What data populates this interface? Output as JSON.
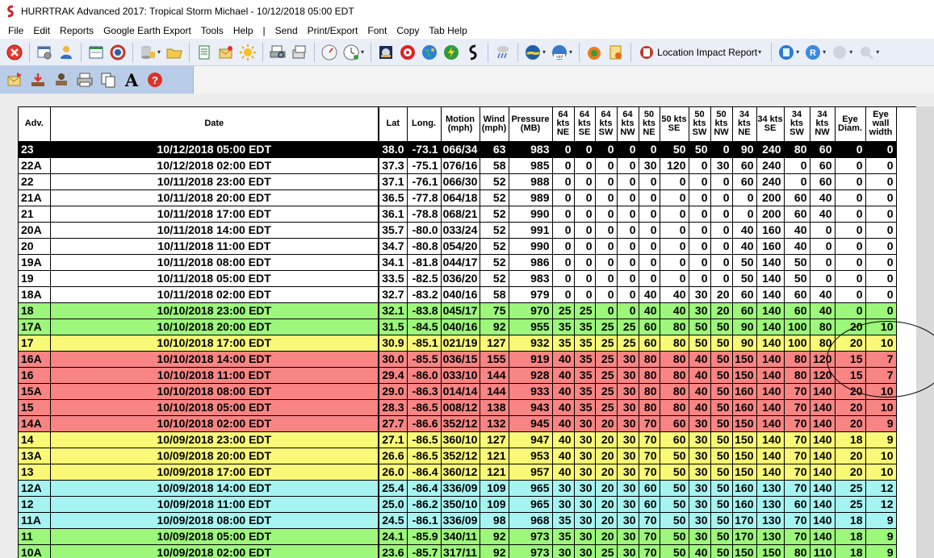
{
  "window": {
    "title": "HURRTRAK Advanced 2017: Tropical Storm Michael - 10/12/2018 05:00 EDT"
  },
  "menu": [
    "File",
    "Edit",
    "Reports",
    "Google Earth Export",
    "Tools",
    "Help",
    "|",
    "Send",
    "Print/Export",
    "Font",
    "Copy",
    "Tab Help"
  ],
  "toolbar": {
    "location_report_label": "Location Impact Report"
  },
  "columns": [
    "Adv.",
    "Date",
    "Lat",
    "Long.",
    "Motion (mph)",
    "Wind (mph)",
    "Pressure (MB)",
    "64 kts NE",
    "64 kts SE",
    "64 kts SW",
    "64 kts NW",
    "50 kts NE",
    "50 kts SE",
    "50 kts SW",
    "50 kts NW",
    "34 kts NE",
    "34 kts SE",
    "34 kts SW",
    "34 kts NW",
    "Eye Diam.",
    "Eye wall width"
  ],
  "row_colors": {
    "black": "#000000",
    "white": "#ffffff",
    "green": "#9cf77a",
    "yellow": "#f9f977",
    "red": "#f98484",
    "cyan": "#a6f4f1"
  },
  "rows": [
    {
      "style": "black",
      "cells": [
        "23",
        "10/12/2018 05:00 EDT",
        "38.0",
        "-73.1",
        "066/34",
        "63",
        "983",
        "0",
        "0",
        "0",
        "0",
        "0",
        "50",
        "50",
        "0",
        "90",
        "240",
        "80",
        "60",
        "0",
        "0"
      ]
    },
    {
      "style": "white",
      "cells": [
        "22A",
        "10/12/2018 02:00 EDT",
        "37.3",
        "-75.1",
        "076/16",
        "58",
        "985",
        "0",
        "0",
        "0",
        "0",
        "30",
        "120",
        "0",
        "30",
        "60",
        "240",
        "0",
        "60",
        "0",
        "0"
      ]
    },
    {
      "style": "white",
      "cells": [
        "22",
        "10/11/2018 23:00 EDT",
        "37.1",
        "-76.1",
        "066/30",
        "52",
        "988",
        "0",
        "0",
        "0",
        "0",
        "0",
        "0",
        "0",
        "0",
        "60",
        "240",
        "0",
        "60",
        "0",
        "0"
      ]
    },
    {
      "style": "white",
      "cells": [
        "21A",
        "10/11/2018 20:00 EDT",
        "36.5",
        "-77.8",
        "064/18",
        "52",
        "989",
        "0",
        "0",
        "0",
        "0",
        "0",
        "0",
        "0",
        "0",
        "0",
        "200",
        "60",
        "40",
        "0",
        "0"
      ]
    },
    {
      "style": "white",
      "cells": [
        "21",
        "10/11/2018 17:00 EDT",
        "36.1",
        "-78.8",
        "068/21",
        "52",
        "990",
        "0",
        "0",
        "0",
        "0",
        "0",
        "0",
        "0",
        "0",
        "0",
        "200",
        "60",
        "40",
        "0",
        "0"
      ]
    },
    {
      "style": "white",
      "cells": [
        "20A",
        "10/11/2018 14:00 EDT",
        "35.7",
        "-80.0",
        "033/24",
        "52",
        "991",
        "0",
        "0",
        "0",
        "0",
        "0",
        "0",
        "0",
        "0",
        "40",
        "160",
        "40",
        "0",
        "0",
        "0"
      ]
    },
    {
      "style": "white",
      "cells": [
        "20",
        "10/11/2018 11:00 EDT",
        "34.7",
        "-80.8",
        "054/20",
        "52",
        "990",
        "0",
        "0",
        "0",
        "0",
        "0",
        "0",
        "0",
        "0",
        "40",
        "160",
        "40",
        "0",
        "0",
        "0"
      ]
    },
    {
      "style": "white",
      "cells": [
        "19A",
        "10/11/2018 08:00 EDT",
        "34.1",
        "-81.8",
        "044/17",
        "52",
        "986",
        "0",
        "0",
        "0",
        "0",
        "0",
        "0",
        "0",
        "0",
        "50",
        "140",
        "50",
        "0",
        "0",
        "0"
      ]
    },
    {
      "style": "white",
      "cells": [
        "19",
        "10/11/2018 05:00 EDT",
        "33.5",
        "-82.5",
        "036/20",
        "52",
        "983",
        "0",
        "0",
        "0",
        "0",
        "0",
        "0",
        "0",
        "0",
        "50",
        "140",
        "50",
        "0",
        "0",
        "0"
      ]
    },
    {
      "style": "white",
      "cells": [
        "18A",
        "10/11/2018 02:00 EDT",
        "32.7",
        "-83.2",
        "040/16",
        "58",
        "979",
        "0",
        "0",
        "0",
        "0",
        "40",
        "40",
        "30",
        "20",
        "60",
        "140",
        "60",
        "40",
        "0",
        "0"
      ]
    },
    {
      "style": "green",
      "cells": [
        "18",
        "10/10/2018 23:00 EDT",
        "32.1",
        "-83.8",
        "045/17",
        "75",
        "970",
        "25",
        "25",
        "0",
        "0",
        "40",
        "40",
        "30",
        "20",
        "60",
        "140",
        "60",
        "40",
        "0",
        "0"
      ]
    },
    {
      "style": "green",
      "cells": [
        "17A",
        "10/10/2018 20:00 EDT",
        "31.5",
        "-84.5",
        "040/16",
        "92",
        "955",
        "35",
        "35",
        "25",
        "25",
        "60",
        "80",
        "50",
        "50",
        "90",
        "140",
        "100",
        "80",
        "20",
        "10"
      ]
    },
    {
      "style": "yellow",
      "cells": [
        "17",
        "10/10/2018 17:00 EDT",
        "30.9",
        "-85.1",
        "021/19",
        "127",
        "932",
        "35",
        "35",
        "25",
        "25",
        "60",
        "80",
        "50",
        "50",
        "90",
        "140",
        "100",
        "80",
        "20",
        "10"
      ]
    },
    {
      "style": "red",
      "cells": [
        "16A",
        "10/10/2018 14:00 EDT",
        "30.0",
        "-85.5",
        "036/15",
        "155",
        "919",
        "40",
        "35",
        "25",
        "30",
        "80",
        "80",
        "40",
        "50",
        "150",
        "140",
        "80",
        "120",
        "15",
        "7"
      ]
    },
    {
      "style": "red",
      "cells": [
        "16",
        "10/10/2018 11:00 EDT",
        "29.4",
        "-86.0",
        "033/10",
        "144",
        "928",
        "40",
        "35",
        "25",
        "30",
        "80",
        "80",
        "40",
        "50",
        "150",
        "140",
        "80",
        "120",
        "15",
        "7"
      ]
    },
    {
      "style": "red",
      "cells": [
        "15A",
        "10/10/2018 08:00 EDT",
        "29.0",
        "-86.3",
        "014/14",
        "144",
        "933",
        "40",
        "35",
        "25",
        "30",
        "80",
        "80",
        "40",
        "50",
        "160",
        "140",
        "70",
        "140",
        "20",
        "10"
      ]
    },
    {
      "style": "red",
      "cells": [
        "15",
        "10/10/2018 05:00 EDT",
        "28.3",
        "-86.5",
        "008/12",
        "138",
        "943",
        "40",
        "35",
        "25",
        "30",
        "80",
        "80",
        "40",
        "50",
        "160",
        "140",
        "70",
        "140",
        "20",
        "10"
      ]
    },
    {
      "style": "red",
      "cells": [
        "14A",
        "10/10/2018 02:00 EDT",
        "27.7",
        "-86.6",
        "352/12",
        "132",
        "945",
        "40",
        "30",
        "20",
        "30",
        "70",
        "60",
        "30",
        "50",
        "150",
        "140",
        "70",
        "140",
        "20",
        "9"
      ]
    },
    {
      "style": "yellow",
      "cells": [
        "14",
        "10/09/2018 23:00 EDT",
        "27.1",
        "-86.5",
        "360/10",
        "127",
        "947",
        "40",
        "30",
        "20",
        "30",
        "70",
        "60",
        "30",
        "50",
        "150",
        "140",
        "70",
        "140",
        "18",
        "9"
      ]
    },
    {
      "style": "yellow",
      "cells": [
        "13A",
        "10/09/2018 20:00 EDT",
        "26.6",
        "-86.5",
        "352/12",
        "121",
        "953",
        "40",
        "30",
        "20",
        "30",
        "70",
        "50",
        "30",
        "50",
        "150",
        "140",
        "70",
        "140",
        "20",
        "10"
      ]
    },
    {
      "style": "yellow",
      "cells": [
        "13",
        "10/09/2018 17:00 EDT",
        "26.0",
        "-86.4",
        "360/12",
        "121",
        "957",
        "40",
        "30",
        "20",
        "30",
        "70",
        "50",
        "30",
        "50",
        "150",
        "140",
        "70",
        "140",
        "20",
        "10"
      ]
    },
    {
      "style": "cyan",
      "cells": [
        "12A",
        "10/09/2018 14:00 EDT",
        "25.4",
        "-86.4",
        "336/09",
        "109",
        "965",
        "30",
        "30",
        "20",
        "30",
        "60",
        "50",
        "30",
        "50",
        "160",
        "130",
        "70",
        "140",
        "25",
        "12"
      ]
    },
    {
      "style": "cyan",
      "cells": [
        "12",
        "10/09/2018 11:00 EDT",
        "25.0",
        "-86.2",
        "350/10",
        "109",
        "965",
        "30",
        "30",
        "20",
        "30",
        "60",
        "50",
        "30",
        "50",
        "160",
        "130",
        "60",
        "140",
        "25",
        "12"
      ]
    },
    {
      "style": "cyan",
      "cells": [
        "11A",
        "10/09/2018 08:00 EDT",
        "24.5",
        "-86.1",
        "336/09",
        "98",
        "968",
        "35",
        "30",
        "20",
        "30",
        "70",
        "50",
        "30",
        "50",
        "170",
        "130",
        "70",
        "140",
        "18",
        "9"
      ]
    },
    {
      "style": "green",
      "cells": [
        "11",
        "10/09/2018 05:00 EDT",
        "24.1",
        "-85.9",
        "340/11",
        "92",
        "973",
        "35",
        "30",
        "20",
        "30",
        "70",
        "50",
        "30",
        "50",
        "170",
        "130",
        "70",
        "140",
        "18",
        "9"
      ]
    },
    {
      "style": "green",
      "cells": [
        "10A",
        "10/09/2018 02:00 EDT",
        "23.6",
        "-85.7",
        "317/11",
        "92",
        "973",
        "30",
        "30",
        "25",
        "30",
        "70",
        "50",
        "40",
        "50",
        "150",
        "150",
        "80",
        "110",
        "18",
        "9"
      ]
    }
  ]
}
